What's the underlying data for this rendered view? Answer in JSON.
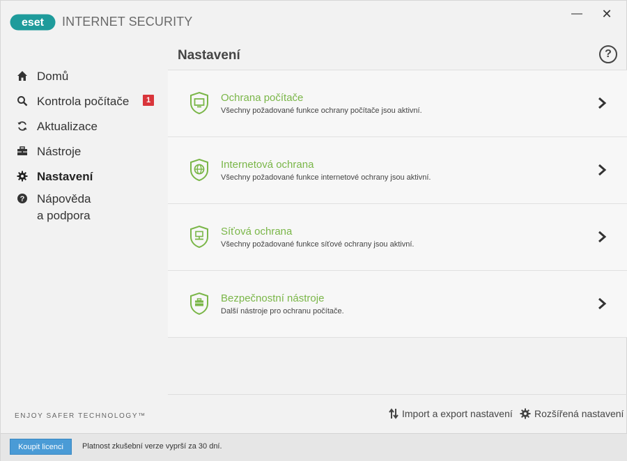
{
  "app": {
    "logo_text": "eset",
    "product_name": "INTERNET SECURITY",
    "brand_color": "#1e9b9b",
    "accent_green": "#7ab648"
  },
  "window_controls": {
    "minimize_label": "—",
    "close_label": "✕"
  },
  "sidebar": {
    "items": [
      {
        "label": "Domů",
        "icon": "home-icon"
      },
      {
        "label": "Kontrola počítače",
        "icon": "search-icon",
        "badge": "1"
      },
      {
        "label": "Aktualizace",
        "icon": "refresh-icon"
      },
      {
        "label": "Nástroje",
        "icon": "toolbox-icon"
      },
      {
        "label": "Nastavení",
        "icon": "gear-icon",
        "active": true
      },
      {
        "label": "Nápověda",
        "label2": "a podpora",
        "icon": "help-circle-icon"
      }
    ],
    "tagline": "ENJOY SAFER TECHNOLOGY™"
  },
  "main": {
    "title": "Nastavení",
    "help_label": "?",
    "panels": [
      {
        "title": "Ochrana počítače",
        "description": "Všechny požadované funkce ochrany počítače jsou aktivní.",
        "icon": "shield-monitor-icon"
      },
      {
        "title": "Internetová ochrana",
        "description": "Všechny požadované funkce internetové ochrany jsou aktivní.",
        "icon": "shield-globe-icon"
      },
      {
        "title": "Síťová ochrana",
        "description": "Všechny požadované funkce síťové ochrany jsou aktivní.",
        "icon": "shield-network-icon"
      },
      {
        "title": "Bezpečnostní nástroje",
        "description": "Další nástroje pro ochranu počítače.",
        "icon": "shield-toolbox-icon"
      }
    ]
  },
  "footer": {
    "import_export_label": "Import a export nastavení",
    "advanced_label": "Rozšířená nastavení"
  },
  "statusbar": {
    "buy_label": "Koupit licenci",
    "trial_text": "Platnost zkušební verze vyprší za 30 dní."
  }
}
